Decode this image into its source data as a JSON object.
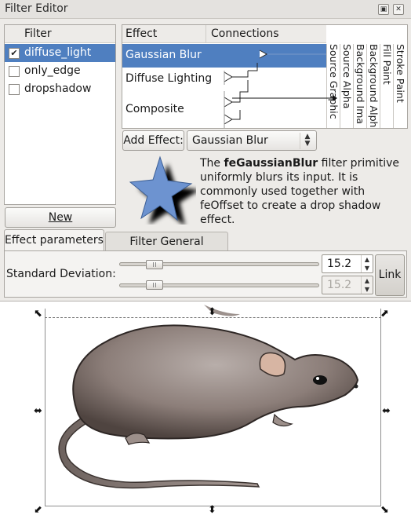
{
  "window": {
    "title": "Filter Editor",
    "title_buttons": [
      "▣",
      "✕"
    ]
  },
  "filters": {
    "header": "Filter",
    "items": [
      {
        "label": "diffuse_light",
        "checked": true,
        "selected": true
      },
      {
        "label": "only_edge",
        "checked": false,
        "selected": false
      },
      {
        "label": "dropshadow",
        "checked": false,
        "selected": false
      }
    ],
    "new_button": "New"
  },
  "effects": {
    "headers": {
      "effect": "Effect",
      "connections": "Connections"
    },
    "items": [
      {
        "label": "Gaussian Blur",
        "selected": true
      },
      {
        "label": "Diffuse Lighting",
        "selected": false
      },
      {
        "label": "Composite",
        "selected": false
      }
    ],
    "inputs": [
      "Source Graphic",
      "Source Alpha",
      "Background Ima",
      "Background Alph",
      "Fill Paint",
      "Stroke Paint"
    ]
  },
  "add_effect": {
    "button": "Add Effect:",
    "selected": "Gaussian Blur"
  },
  "description": {
    "prefix": "The ",
    "primitive": "feGaussianBlur",
    "suffix": " filter primitive uniformly blurs its input.  It is commonly used together with feOffset to create a drop shadow effect."
  },
  "tabs": [
    {
      "label": "Effect parameters",
      "active": true
    },
    {
      "label": "Filter General Settings",
      "active": false
    }
  ],
  "parameters": {
    "label": "Standard Deviation:",
    "value_x": "15.2",
    "value_y": "15.2",
    "link_button": "Link"
  },
  "colors": {
    "selection": "#4f7fc0",
    "star_fill": "#6d93d0",
    "rat_body": "#8c7e79"
  }
}
